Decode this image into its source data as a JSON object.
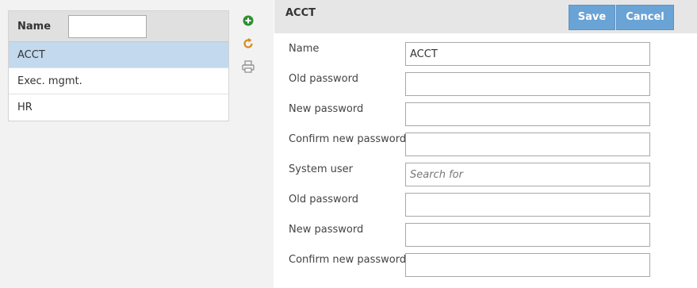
{
  "list": {
    "header": "Name",
    "filter_value": "",
    "rows": [
      {
        "label": "ACCT",
        "selected": true
      },
      {
        "label": "Exec. mgmt.",
        "selected": false
      },
      {
        "label": "HR",
        "selected": false
      }
    ]
  },
  "tools": {
    "add_icon": "plus-circle-icon",
    "refresh_icon": "refresh-icon",
    "print_icon": "printer-icon",
    "add_color": "#2f8f2f",
    "refresh_color": "#d98a1e",
    "print_color": "#888888"
  },
  "detail": {
    "title": "ACCT",
    "save_label": "Save",
    "cancel_label": "Cancel",
    "button_color": "#6aa3d5",
    "fields": [
      {
        "label": "Name",
        "value": "ACCT",
        "placeholder": ""
      },
      {
        "label": "Old password",
        "value": "",
        "placeholder": ""
      },
      {
        "label": "New password",
        "value": "",
        "placeholder": ""
      },
      {
        "label": "Confirm new password",
        "value": "",
        "placeholder": ""
      },
      {
        "label": "System user",
        "value": "",
        "placeholder": "Search for"
      },
      {
        "label": "Old password",
        "value": "",
        "placeholder": ""
      },
      {
        "label": "New password",
        "value": "",
        "placeholder": ""
      },
      {
        "label": "Confirm new password",
        "value": "",
        "placeholder": ""
      }
    ]
  }
}
